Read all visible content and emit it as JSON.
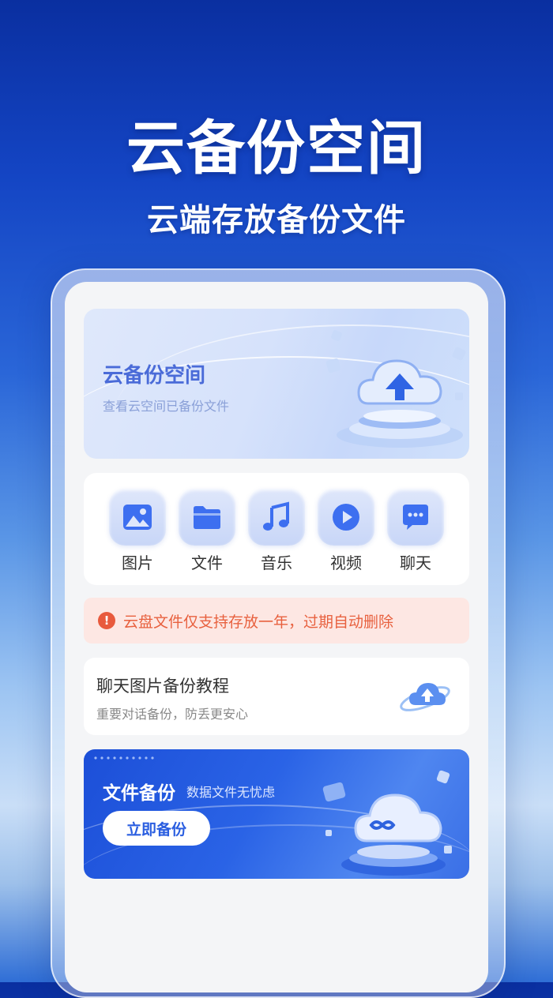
{
  "promo": {
    "title": "云备份空间",
    "subtitle": "云端存放备份文件"
  },
  "hero": {
    "title": "云备份空间",
    "subtitle": "查看云空间已备份文件"
  },
  "categories": [
    {
      "label": "图片",
      "icon": "image-icon"
    },
    {
      "label": "文件",
      "icon": "folder-icon"
    },
    {
      "label": "音乐",
      "icon": "music-icon"
    },
    {
      "label": "视频",
      "icon": "video-icon"
    },
    {
      "label": "聊天",
      "icon": "chat-icon"
    }
  ],
  "warning": {
    "icon": "exclamation-icon",
    "text": "云盘文件仅支持存放一年，过期自动删除"
  },
  "tutorial": {
    "title": "聊天图片备份教程",
    "subtitle": "重要对话备份，防丢更安心"
  },
  "backup_banner": {
    "title": "文件备份",
    "subtitle": "数据文件无忧虑",
    "button_label": "立即备份"
  },
  "colors": {
    "accent": "#3d6ff0",
    "warning_text": "#e8613f",
    "warning_bg": "#fde7e3"
  }
}
